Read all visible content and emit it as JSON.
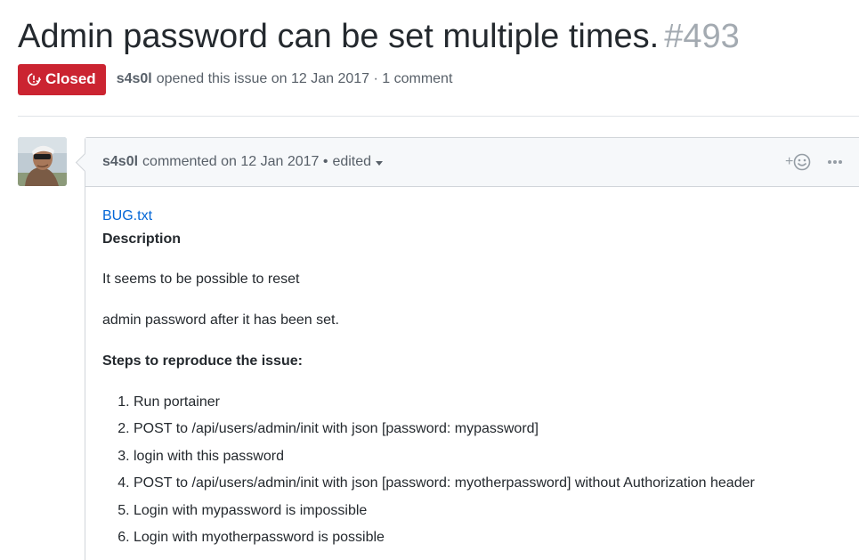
{
  "issue": {
    "title": "Admin password can be set multiple times.",
    "number": "#493",
    "state": "Closed",
    "author": "s4s0l",
    "meta_text": "opened this issue on 12 Jan 2017 · 1 comment"
  },
  "comment": {
    "author": "s4s0l",
    "meta_text": "commented on 12 Jan 2017 •",
    "edited_label": "edited",
    "reaction_label": "+",
    "attachment": "BUG.txt",
    "description_heading": "Description",
    "paragraphs": [
      "It seems to be possible to reset",
      "admin password after it has been set."
    ],
    "steps_heading": "Steps to reproduce the issue:",
    "steps": [
      "Run portainer",
      "POST to /api/users/admin/init with json [password: mypassword]",
      "login with this password",
      "POST to /api/users/admin/init with json [password: myotherpassword] without Authorization header",
      "Login with mypassword is impossible",
      "Login with myotherpassword is possible"
    ]
  },
  "icons": {
    "state": "issue-closed-icon",
    "reaction": "smiley-icon",
    "more": "kebab-horizontal-icon"
  },
  "colors": {
    "closed_badge": "#cb2431",
    "link": "#0366d6",
    "muted": "#586069",
    "issue_number": "#a3aab1"
  }
}
